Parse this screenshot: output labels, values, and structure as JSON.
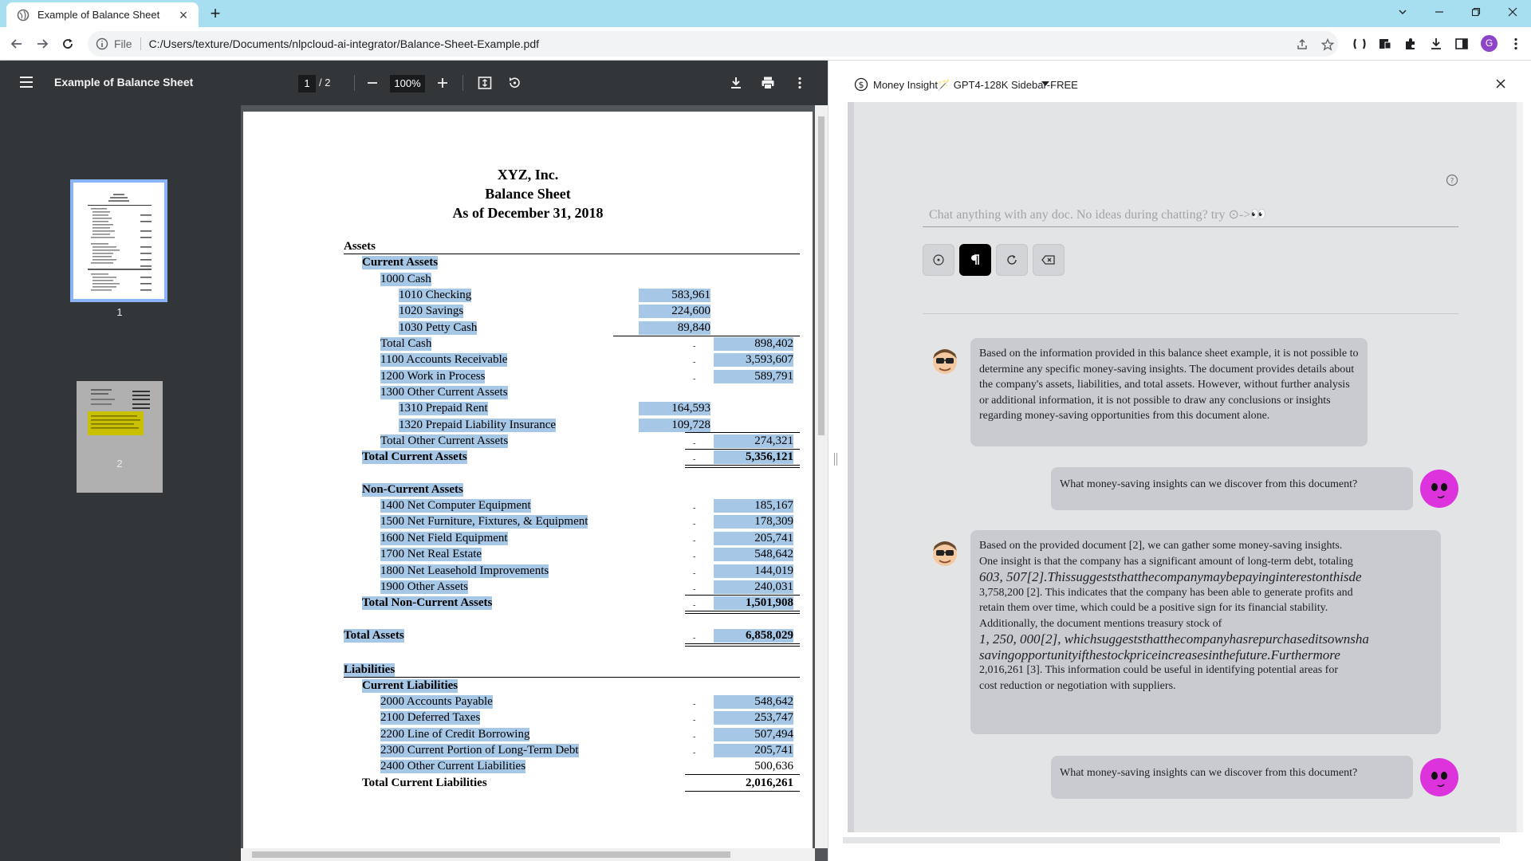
{
  "browser": {
    "tab_title": "Example of Balance Sheet",
    "new_tab": "+",
    "url_scheme": "File",
    "url": "C:/Users/texture/Documents/nlpcloud-ai-integrator/Balance-Sheet-Example.pdf",
    "profile_initial": "G"
  },
  "pdf": {
    "title": "Example of Balance Sheet",
    "page_current": "1",
    "page_total": "/ 2",
    "zoom": "100%",
    "thumbnails": [
      "1",
      "2"
    ]
  },
  "sheet": {
    "company": "XYZ, Inc.",
    "title": "Balance Sheet",
    "date": "As of December 31, 2018",
    "assets": "Assets",
    "current_assets": "Current Assets",
    "cash": "1000 Cash",
    "checking": "1010 Checking",
    "checking_val": "583,961",
    "savings": "1020 Savings",
    "savings_val": "224,600",
    "petty": "1030 Petty Cash",
    "petty_val": "89,840",
    "total_cash": "Total Cash",
    "total_cash_val": "898,402",
    "ar": "1100 Accounts Receivable",
    "ar_val": "3,593,607",
    "wip": "1200 Work in Process",
    "wip_val": "589,791",
    "oca": "1300 Other Current Assets",
    "rent": "1310 Prepaid Rent",
    "rent_val": "164,593",
    "ins": "1320 Prepaid Liability Insurance",
    "ins_val": "109,728",
    "total_oca": "Total Other Current Assets",
    "total_oca_val": "274,321",
    "total_ca": "Total Current Assets",
    "total_ca_val": "5,356,121",
    "nca": "Non-Current Assets",
    "comp": "1400 Net Computer Equipment",
    "comp_val": "185,167",
    "furn": "1500 Net Furniture, Fixtures, & Equipment",
    "furn_val": "178,309",
    "field": "1600 Net Field Equipment",
    "field_val": "205,741",
    "re": "1700 Net Real Estate",
    "re_val": "548,642",
    "lease": "1800 Net Leasehold Improvements",
    "lease_val": "144,019",
    "other": "1900 Other Assets",
    "other_val": "240,031",
    "total_nca": "Total Non-Current Assets",
    "total_nca_val": "1,501,908",
    "total_assets": "Total Assets",
    "total_assets_val": "6,858,029",
    "liabilities": "Liabilities",
    "cl": "Current Liabilities",
    "ap": "2000 Accounts Payable",
    "ap_val": "548,642",
    "dt": "2100 Deferred Taxes",
    "dt_val": "253,747",
    "loc": "2200 Line of Credit Borrowing",
    "loc_val": "507,494",
    "cpltd": "2300 Current Portion of Long-Term Debt",
    "cpltd_val": "205,741",
    "ocl": "2400 Other Current Liabilities",
    "ocl_val": "500,636",
    "total_cl": "Total Current Liabilities",
    "total_cl_val": "2,016,261",
    "dash": "-"
  },
  "side": {
    "title": "Money Insight🪄 GPT4-128K Sidebar-FREE",
    "input_placeholder": "Chat anything with any doc. No ideas during chatting? try ⊙->👀",
    "messages": [
      {
        "role": "bot",
        "text": "Based on the information provided in this balance sheet example, it is not possible to determine any specific money-saving insights. The document provides details about the company's assets, liabilities, and total assets. However, without further analysis or additional information, it is not possible to draw any conclusions or insights regarding money-saving opportunities from this document alone."
      },
      {
        "role": "user",
        "text": "What money-saving insights can we discover from this document?"
      },
      {
        "role": "bot",
        "line1": "Based on the provided document [2], we can gather some money-saving insights. One insight is that the company has a significant amount of long-term debt, totaling",
        "math1": "603, 507[2].Thissuggeststhatthecompanymaybepayinginterestonthisde",
        "line2": "3,758,200 [2]. This indicates that the company has been able to generate profits and retain them over time, which could be a positive sign for its financial stability. Additionally, the document mentions treasury stock of",
        "math2": "1, 250, 000[2], whichsuggeststhatthecompanyhasrepurchaseditsownsha",
        "math3": "savingopportunityifthestockpriceincreasesinthefuture.Furthermore",
        "line3": "2,016,261 [3]. This information could be useful in identifying potential areas for cost reduction or negotiation with suppliers."
      },
      {
        "role": "user",
        "text": "What money-saving insights can we discover from this document?"
      }
    ]
  }
}
